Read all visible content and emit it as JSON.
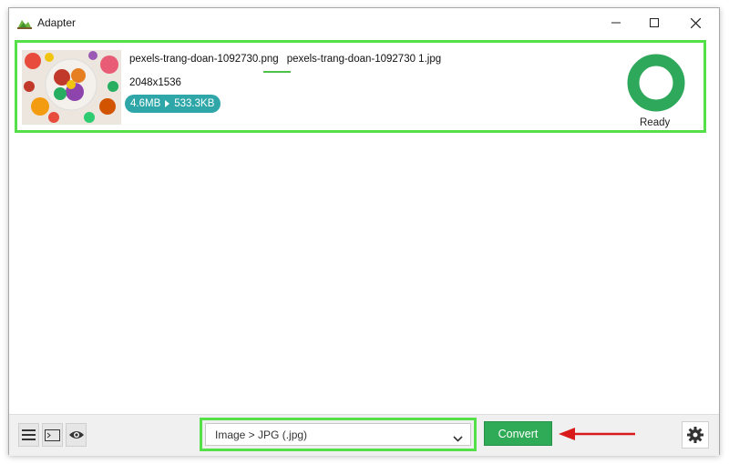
{
  "window": {
    "title": "Adapter",
    "app_icon": "adapter-logo-icon",
    "controls": [
      "minimize-icon",
      "maximize-icon",
      "close-icon"
    ]
  },
  "file": {
    "source_name_base": "pexels-trang-doan-1092730",
    "source_ext": ".png",
    "output_name": "pexels-trang-doan-1092730 1.jpg",
    "dimensions": "2048x1536",
    "original_size": "4.6MB",
    "converted_size": "533.3KB",
    "status": "Ready",
    "progress_percent": 100,
    "thumbnail": "food-photo-thumbnail"
  },
  "toolbar": {
    "left_icons": [
      "menu-icon",
      "terminal-icon",
      "eye-icon"
    ],
    "format_selected": "Image > JPG (.jpg)",
    "convert_label": "Convert",
    "settings_icon": "gear-icon"
  },
  "colors": {
    "highlight": "#55e04a",
    "accent_teal": "#2fa7a9",
    "convert_green": "#2faa57",
    "progress_green": "#2ea85a",
    "annotation_arrow": "#d81a1a"
  }
}
